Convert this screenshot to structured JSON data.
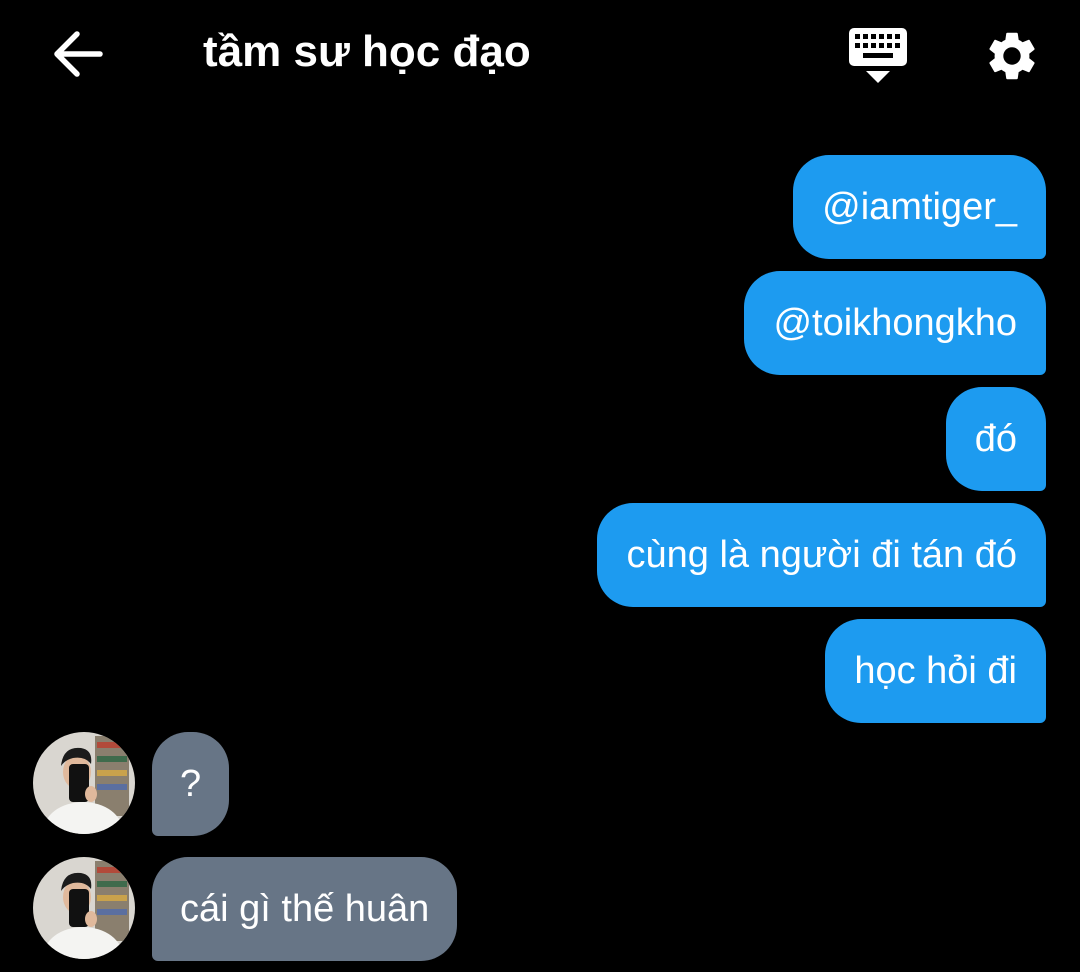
{
  "header": {
    "title": "tầm sư học đạo",
    "back_icon": "arrow-left-icon",
    "keyboard_icon": "keyboard-icon",
    "settings_icon": "gear-icon"
  },
  "messages": {
    "sent": [
      {
        "text": "@iamtiger_"
      },
      {
        "text": "@toikhongkho"
      },
      {
        "text": "đó"
      },
      {
        "text": "cùng là người đi tán đó"
      },
      {
        "text": "học hỏi đi"
      }
    ],
    "received": [
      {
        "text": "?",
        "avatar": "avatar"
      },
      {
        "text": "cái gì thế huân",
        "avatar": "avatar"
      }
    ]
  },
  "colors": {
    "background": "#000000",
    "sent_bubble": "#1d9bf0",
    "received_bubble": "#677586",
    "text": "#ffffff"
  }
}
